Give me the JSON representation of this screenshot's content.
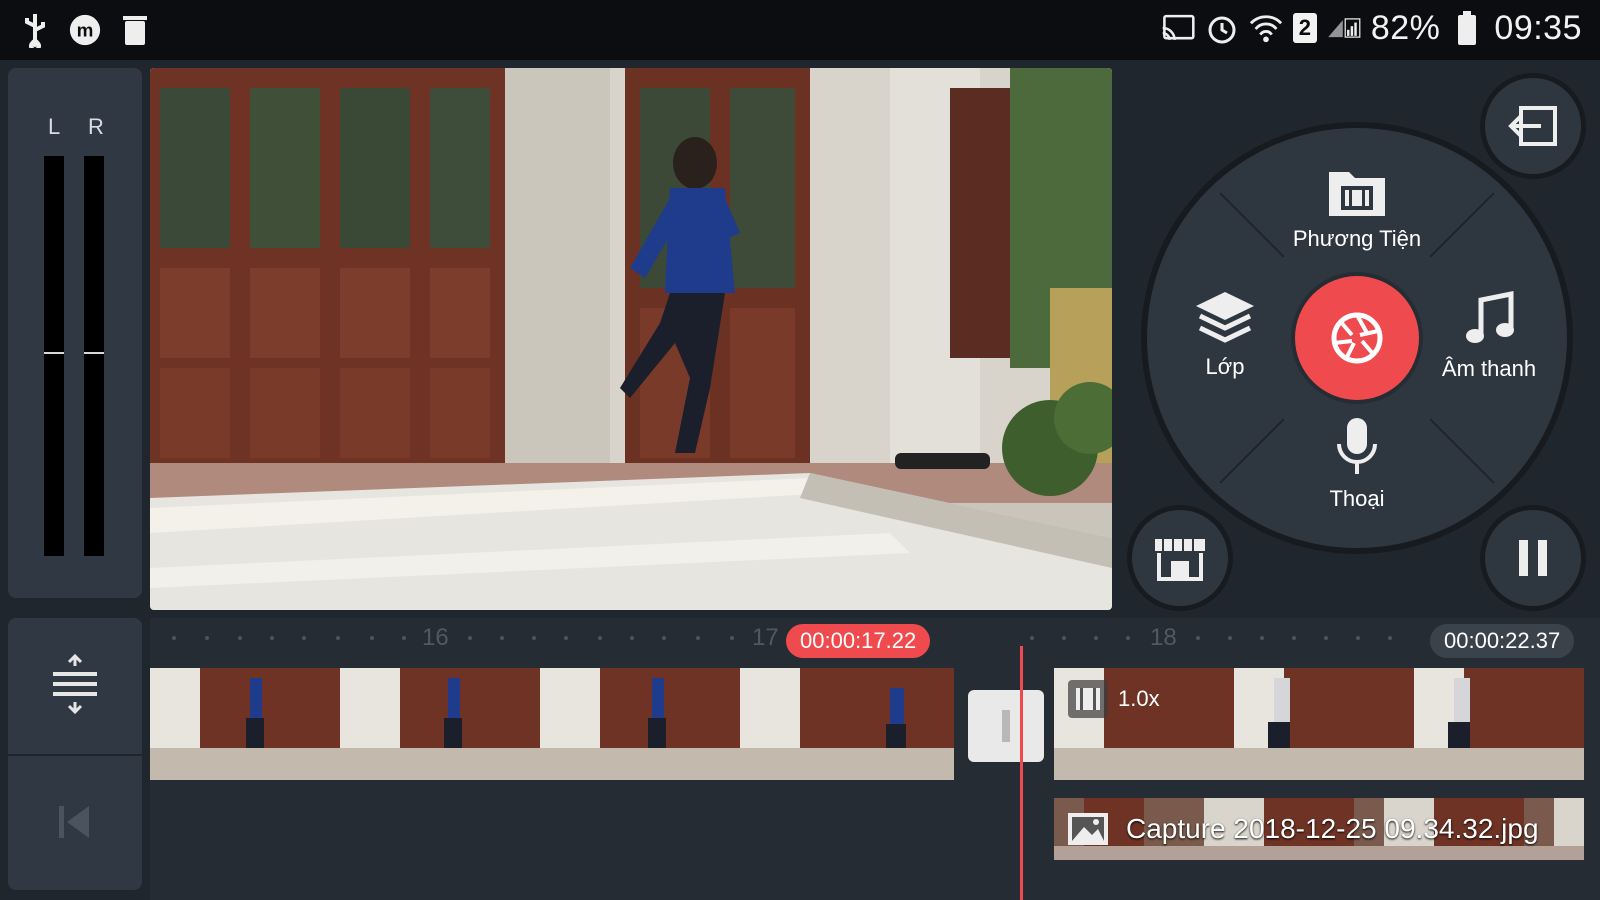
{
  "status_bar": {
    "battery": "82%",
    "time": "09:35",
    "sim_slot": "2",
    "left_icons": [
      "usb-icon",
      "messenger-icon",
      "trash-icon"
    ],
    "right_icons": [
      "cast-icon",
      "alarm-icon",
      "wifi-icon",
      "signal-icon",
      "battery-icon"
    ]
  },
  "meter": {
    "left_label": "L",
    "right_label": "R"
  },
  "menu": {
    "media_label": "Phương Tiện",
    "layer_label": "Lớp",
    "audio_label": "Âm thanh",
    "voice_label": "Thoại"
  },
  "timeline": {
    "current_time": "00:00:17.22",
    "total_time": "00:00:22.37",
    "ticks": [
      "16",
      "17",
      "18"
    ],
    "clip_speed": "1.0x",
    "layer_clip_name": "Capture 2018-12-25 09.34.32.jpg"
  },
  "colors": {
    "accent": "#ef4b4e",
    "panel": "#2f3843",
    "background": "#20262d"
  }
}
